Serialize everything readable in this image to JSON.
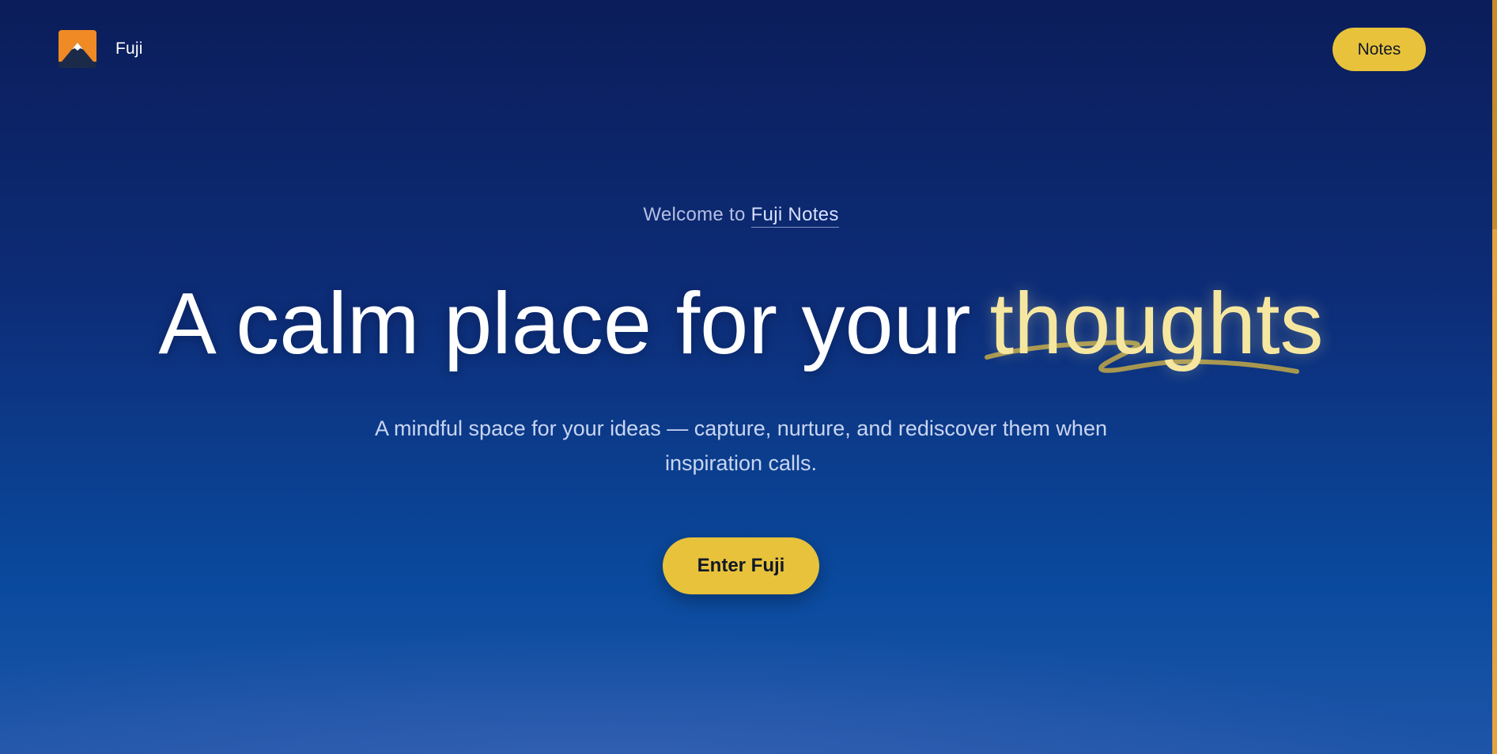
{
  "header": {
    "brand_name": "Fuji",
    "notes_button_label": "Notes"
  },
  "hero": {
    "eyebrow_prefix": "Welcome to ",
    "eyebrow_link": "Fuji Notes",
    "headline_main": "A calm place for your",
    "headline_accent": "thoughts",
    "subtitle_line1": "A mindful space for your ideas — capture, nurture, and rediscover them when",
    "subtitle_line2": "inspiration calls.",
    "cta_label": "Enter Fuji"
  },
  "colors": {
    "accent": "#e8c23a",
    "accent_text": "#f6e7a0",
    "background_top": "#0b1d5a",
    "background_bottom": "#1e55a8"
  },
  "icons": {
    "brand_logo": "mountain-logo-icon"
  }
}
